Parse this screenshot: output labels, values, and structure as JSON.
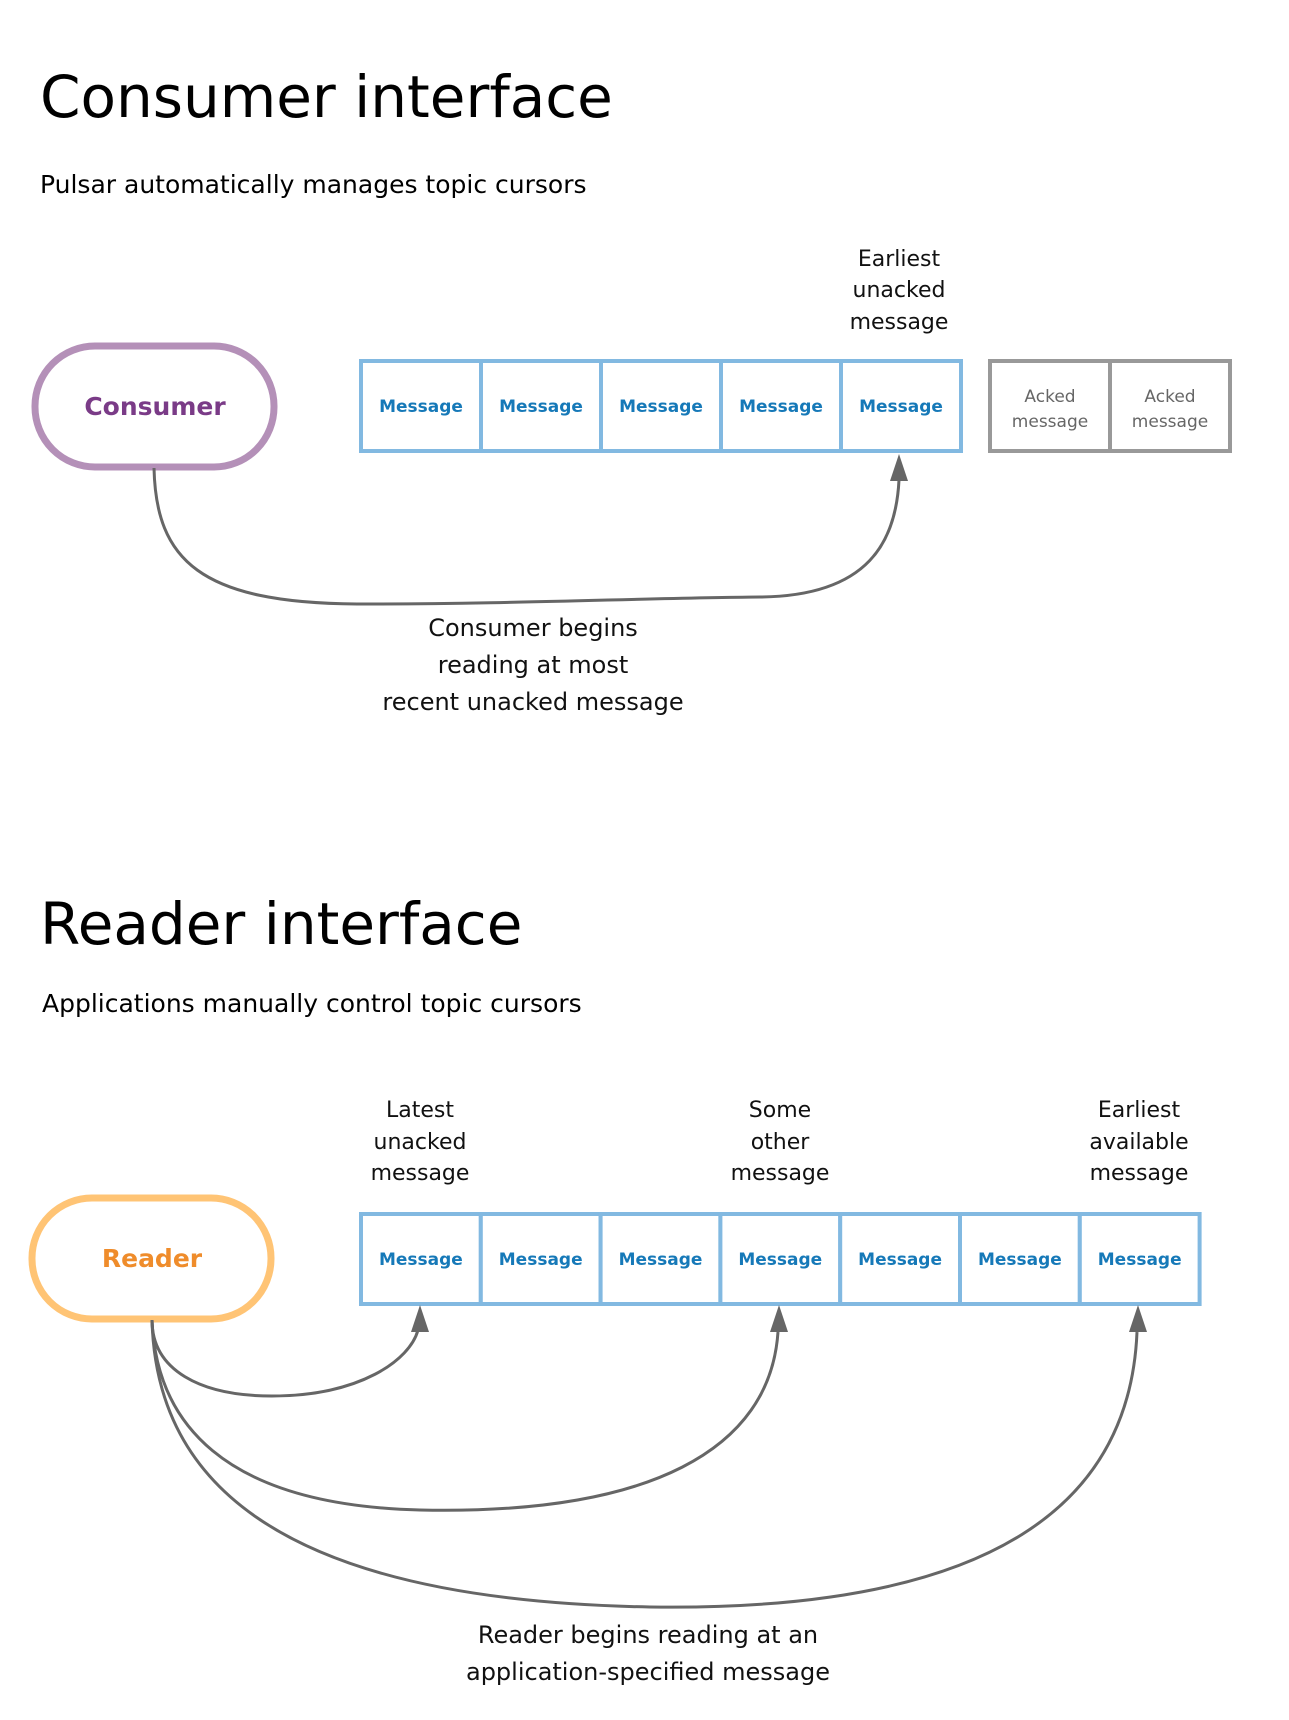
{
  "consumer_section": {
    "title": "Consumer interface",
    "subtitle": "Pulsar automatically manages topic cursors",
    "node_label": "Consumer",
    "node_color": "#7a3b87",
    "node_border_color": "#b490b8",
    "messages": [
      "Message",
      "Message",
      "Message",
      "Message",
      "Message"
    ],
    "acked_messages": [
      {
        "line1": "Acked",
        "line2": "message"
      },
      {
        "line1": "Acked",
        "line2": "message"
      }
    ],
    "pointer_label": [
      "Earliest",
      "unacked",
      "message"
    ],
    "pointer_target_index": 4,
    "caption": [
      "Consumer begins",
      "reading at most",
      "recent unacked message"
    ]
  },
  "reader_section": {
    "title": "Reader interface",
    "subtitle": "Applications manually control topic cursors",
    "node_label": "Reader",
    "node_color": "#ef8c2b",
    "node_border_color": "#ffc475",
    "messages": [
      "Message",
      "Message",
      "Message",
      "Message",
      "Message",
      "Message",
      "Message"
    ],
    "pointers": [
      {
        "label": [
          "Latest",
          "unacked",
          "message"
        ],
        "target_index": 0
      },
      {
        "label": [
          "Some",
          "other",
          "message"
        ],
        "target_index": 3
      },
      {
        "label": [
          "Earliest",
          "available",
          "message"
        ],
        "target_index": 6
      }
    ],
    "caption": [
      "Reader begins reading at an",
      "application-specified message"
    ]
  },
  "colors": {
    "message_border": "#82b9e1",
    "message_text": "#1679b8",
    "acked_border": "#999999",
    "arrow": "#666666"
  }
}
